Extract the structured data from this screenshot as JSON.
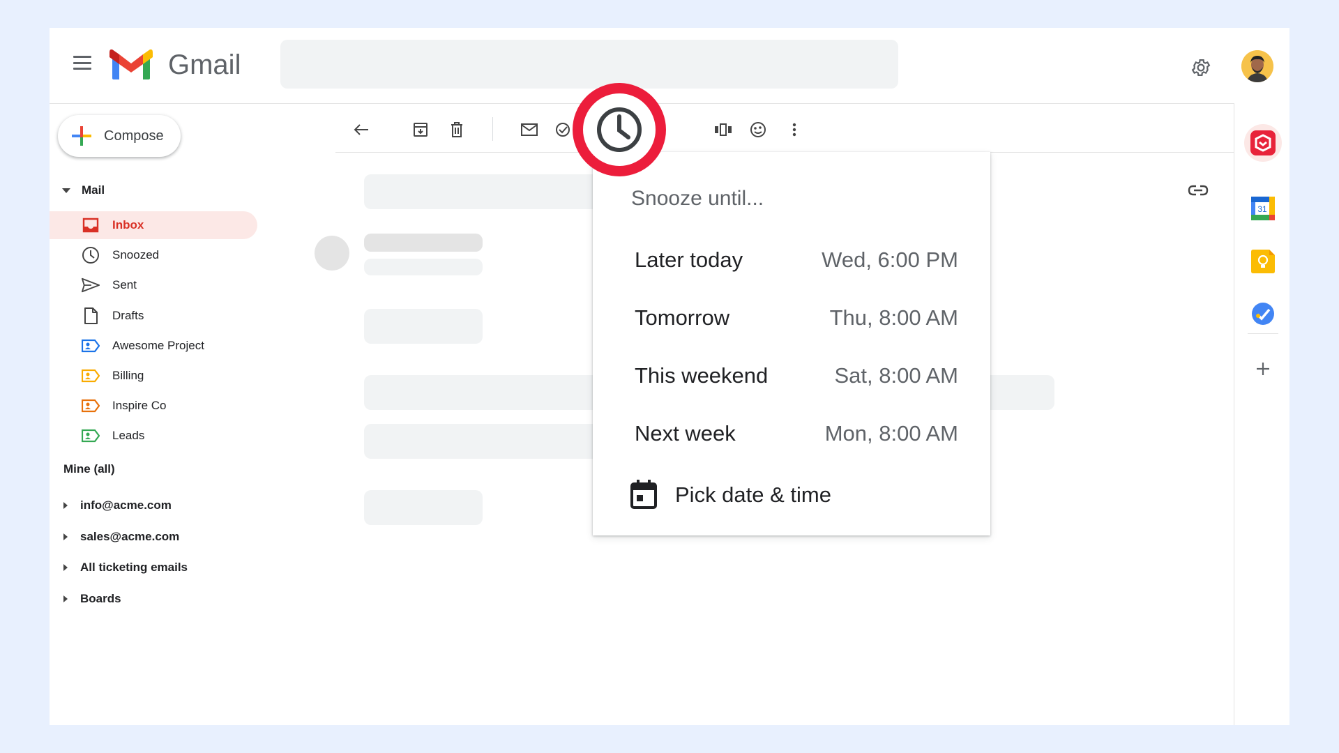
{
  "app": {
    "name": "Gmail"
  },
  "compose": {
    "label": "Compose"
  },
  "sidebar": {
    "mail_section": "Mail",
    "items": [
      {
        "label": "Inbox",
        "icon": "inbox-icon",
        "active": true
      },
      {
        "label": "Snoozed",
        "icon": "clock-icon"
      },
      {
        "label": "Sent",
        "icon": "send-icon"
      },
      {
        "label": "Drafts",
        "icon": "draft-icon"
      },
      {
        "label": "Awesome Project",
        "icon": "label-icon",
        "color": "#1a73e8"
      },
      {
        "label": "Billing",
        "icon": "label-icon",
        "color": "#f9ab00"
      },
      {
        "label": "Inspire Co",
        "icon": "label-icon",
        "color": "#e8710a"
      },
      {
        "label": "Leads",
        "icon": "label-icon",
        "color": "#34a853"
      }
    ],
    "mine_section": "Mine (all)",
    "accounts": [
      {
        "label": "info@acme.com"
      },
      {
        "label": "sales@acme.com"
      },
      {
        "label": "All ticketing emails"
      },
      {
        "label": "Boards"
      }
    ]
  },
  "toolbar": {
    "icons": [
      "back-arrow-icon",
      "archive-icon",
      "delete-icon",
      "mark-unread-icon",
      "add-task-icon",
      "snooze-icon",
      "move-icon",
      "emoji-icon",
      "more-vert-icon"
    ]
  },
  "snooze": {
    "title": "Snooze until...",
    "options": [
      {
        "label": "Later today",
        "time": "Wed, 6:00 PM"
      },
      {
        "label": "Tomorrow",
        "time": "Thu, 8:00 AM"
      },
      {
        "label": "This weekend",
        "time": "Sat, 8:00 AM"
      },
      {
        "label": "Next week",
        "time": "Mon, 8:00 AM"
      }
    ],
    "pick_label": "Pick date & time"
  },
  "side_panel": {
    "apps": [
      "hiver-app-icon",
      "calendar-app-icon",
      "keep-app-icon",
      "tasks-app-icon"
    ],
    "calendar_day": "31"
  },
  "colors": {
    "accent_red": "#ea4335",
    "highlight_ring": "#ec1d3b",
    "active_bg": "#fce8e6"
  }
}
